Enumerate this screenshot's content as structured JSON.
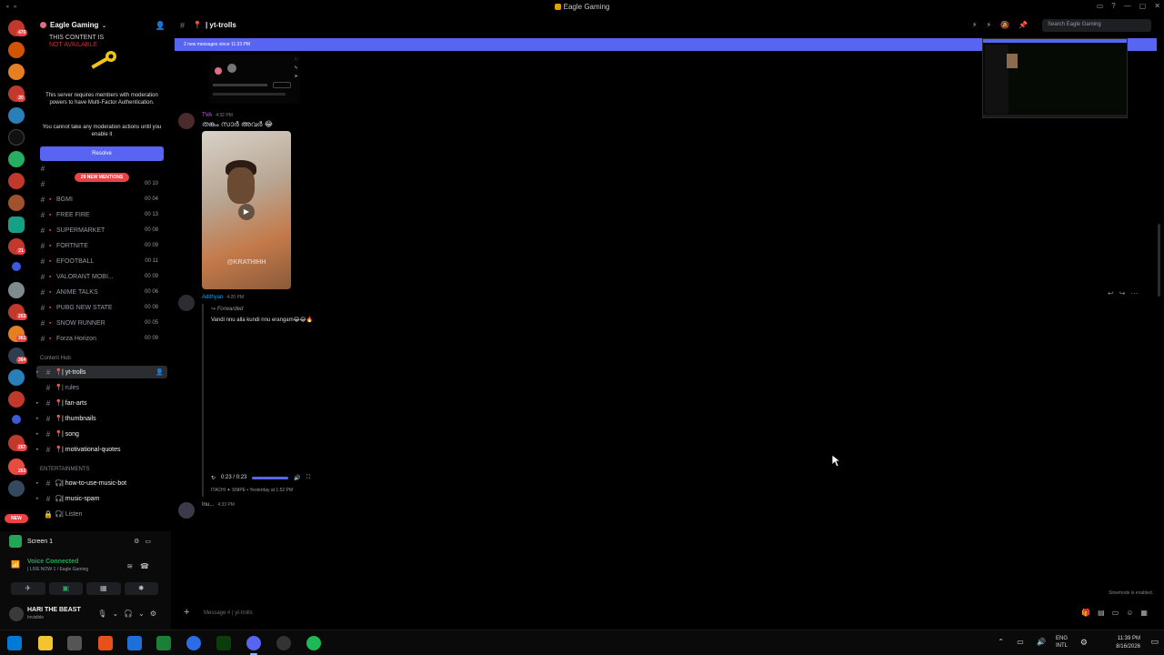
{
  "window": {
    "title": "Eagle Gaming"
  },
  "rail": {
    "new_label": "NEW",
    "badges": [
      "470",
      "20",
      "21",
      "263",
      "361",
      "364",
      "267",
      "263"
    ]
  },
  "server": {
    "name": "Eagle Gaming"
  },
  "mfa": {
    "watermark_line1": "THIS CONTENT IS",
    "watermark_line2": "NOT AVAILABLE",
    "message": "This server requires members with moderation powers to have Multi-Factor Authentication.",
    "message2": "You cannot take any moderation actions until you enable it",
    "resolve_label": "Resolve"
  },
  "new_mentions": "29 NEW MENTIONS",
  "channels": [
    {
      "name": "BGMI",
      "count": "00 04"
    },
    {
      "name": "FREE FIRE",
      "count": "00 13"
    },
    {
      "name": "SUPERMARKET",
      "count": "00 08"
    },
    {
      "name": "FORTNITE",
      "count": "00 09"
    },
    {
      "name": "EFOOTBALL",
      "count": "00 11"
    },
    {
      "name": "VALORANT MOBI...",
      "count": "00 09"
    },
    {
      "name": "ANIME TALKS",
      "count": "00 06"
    },
    {
      "name": "PUBG NEW STATE",
      "count": "00 08"
    },
    {
      "name": "SNOW RUNNER",
      "count": "00 05"
    },
    {
      "name": "Forza Horizon",
      "count": "00 09"
    }
  ],
  "first_channel_count": "00 10",
  "categories": {
    "content_hub": "Content Hub",
    "entertainments": "ENTERTAINMENTS"
  },
  "content_channels": [
    "| yt-trolls",
    "| rules",
    "| fan-arts",
    "| thumbnails",
    "| song",
    "| motivational-quotes"
  ],
  "ent_channels": [
    "| how-to-use-music-bot",
    "| music-spam",
    "| Listen"
  ],
  "panel": {
    "screen_label": "Screen 1",
    "voice_title": "Voice Connected",
    "voice_sub": "| LIVE NOW 1 / Eagle Gaming",
    "user_name": "HARI THE BEAST",
    "user_status": "Invisible"
  },
  "channel": {
    "name": "| yt-trolls",
    "search_placeholder": "Search Eagle Gaming",
    "new_messages_bar": "2 new messages since 11:33 PM",
    "composer_placeholder": "Message #   | yt-trolls",
    "slowmode": "Slowmode is enabled."
  },
  "messages": [
    {
      "author": "TVA",
      "timestamp": "4:32 PM",
      "text": "തങ്കം സാർ അവർ 😂",
      "author_color": "#e056fd"
    },
    {
      "author": "Adithyan",
      "timestamp": "4:20 PM",
      "forwarded_label": "Forwarded",
      "forwarded_text": "Vandi nnu alla kundi nnu erangam😂😂🔥",
      "video_time": "0:23 / 0:23",
      "source": "ITACHI ✦ SNIPE • Yesterday at 1:52 PM",
      "author_color": "#00a8fc"
    },
    {
      "author": "Inu...",
      "timestamp": "4:33 PM",
      "author_color": "#b5bac1"
    }
  ],
  "video_watermark": "@KRATHIHH",
  "taskbar": {
    "lang_line1": "ENG",
    "lang_line2": "INTL",
    "time": "11:39 PM",
    "date": "8/16/2026"
  },
  "colors": {
    "blurple": "#5865f2",
    "red": "#ed4245",
    "green": "#23a559"
  }
}
